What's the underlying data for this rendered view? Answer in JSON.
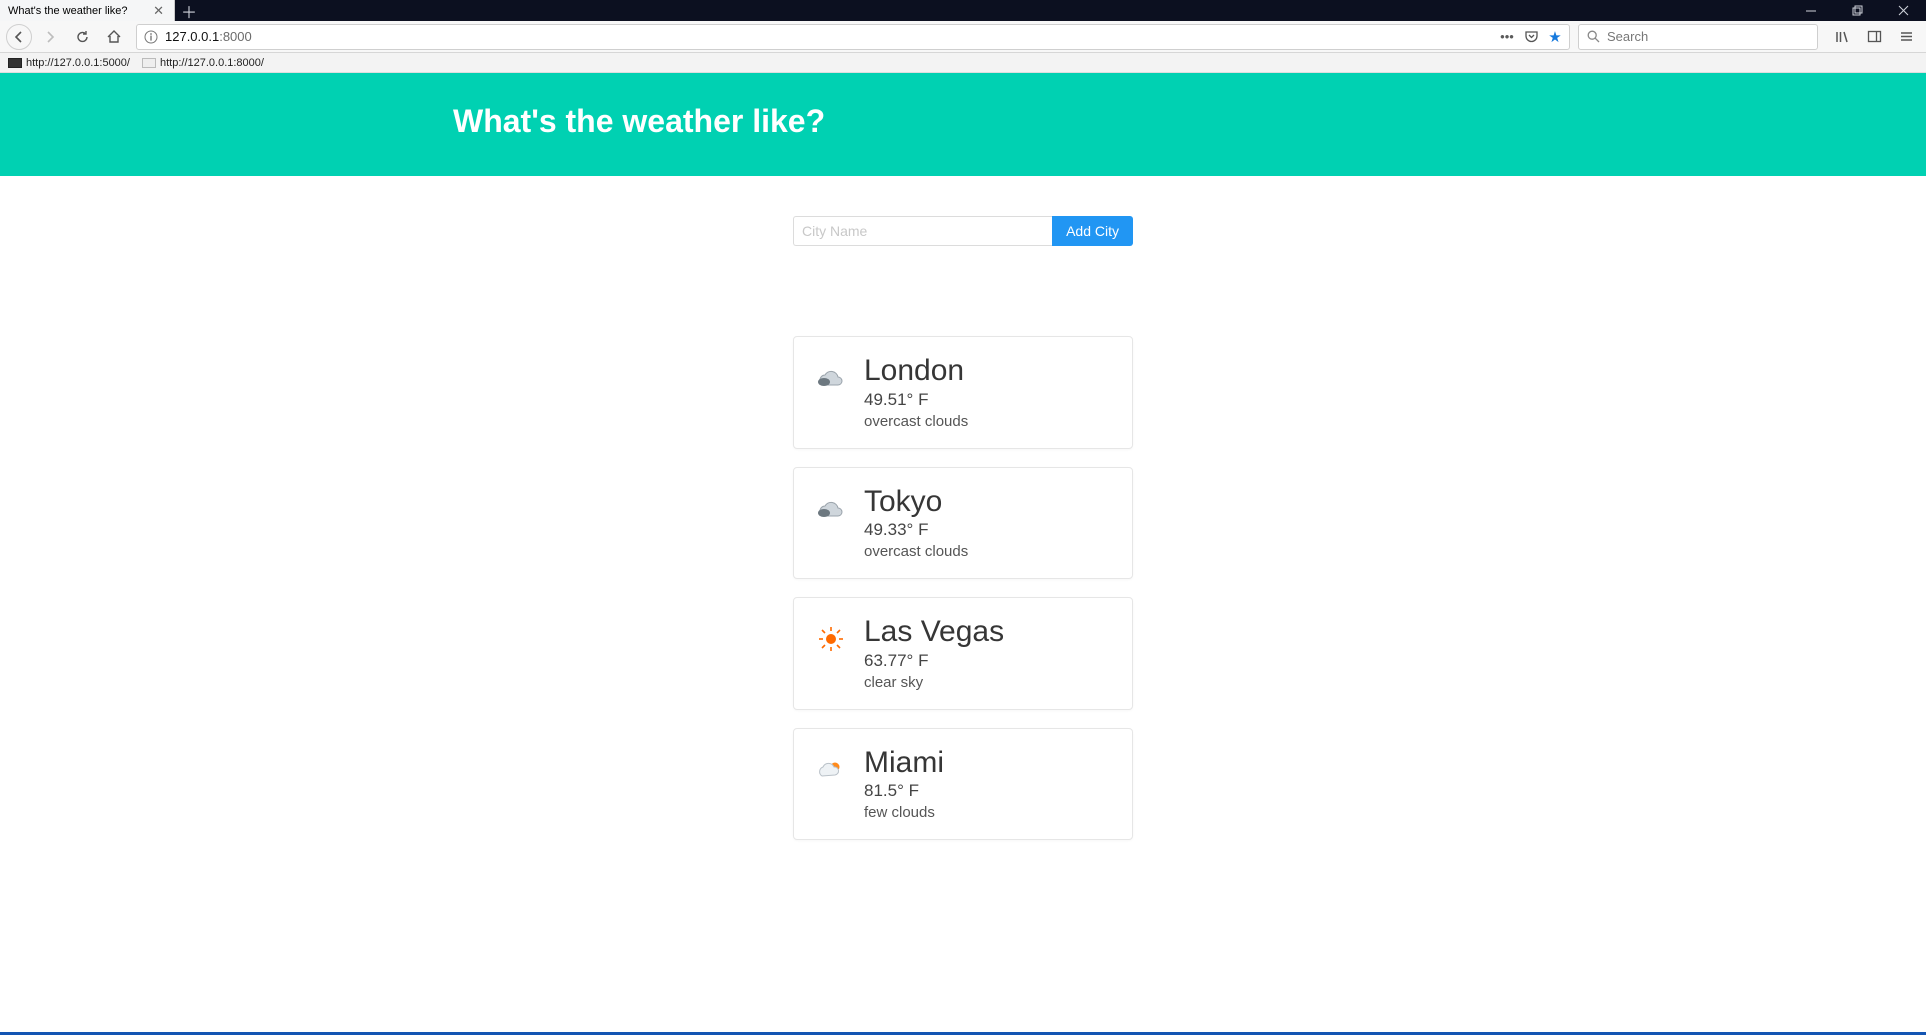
{
  "window": {
    "tab_title": "What's the weather like?",
    "new_tab_tooltip": "Open a new tab"
  },
  "nav": {
    "url_display_host": "127.0.0.1",
    "url_display_port": ":8000",
    "search_placeholder": "Search"
  },
  "bookmarks": [
    {
      "label": "http://127.0.0.1:5000/"
    },
    {
      "label": "http://127.0.0.1:8000/"
    }
  ],
  "page": {
    "hero_title": "What's the weather like?",
    "input_placeholder": "City Name",
    "add_button_label": "Add City",
    "cities": [
      {
        "name": "London",
        "temp": "49.51° F",
        "desc": "overcast clouds",
        "icon": "overcast"
      },
      {
        "name": "Tokyo",
        "temp": "49.33° F",
        "desc": "overcast clouds",
        "icon": "overcast"
      },
      {
        "name": "Las Vegas",
        "temp": "63.77° F",
        "desc": "clear sky",
        "icon": "clear"
      },
      {
        "name": "Miami",
        "temp": "81.5° F",
        "desc": "few clouds",
        "icon": "few"
      }
    ]
  }
}
